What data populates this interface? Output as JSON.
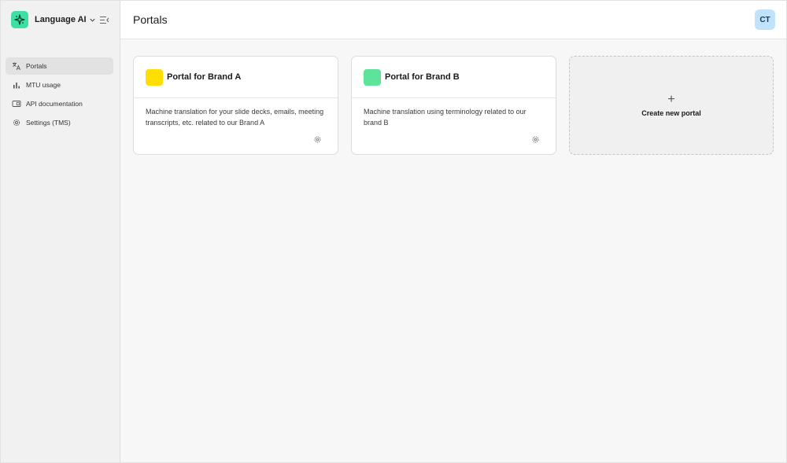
{
  "sidebar": {
    "app_name": "Language AI",
    "nav": [
      {
        "label": "Portals",
        "icon": "translate-icon",
        "active": true
      },
      {
        "label": "MTU usage",
        "icon": "bar-chart-icon",
        "active": false
      },
      {
        "label": "API documentation",
        "icon": "api-doc-icon",
        "active": false
      },
      {
        "label": "Settings (TMS)",
        "icon": "gear-icon",
        "active": false
      }
    ]
  },
  "header": {
    "title": "Portals",
    "avatar_initials": "CT"
  },
  "portals": [
    {
      "title": "Portal for Brand A",
      "description": "Machine translation for your slide decks, emails, meeting transcripts, etc. related to our Brand A",
      "color": "#ffde00"
    },
    {
      "title": "Portal for Brand B",
      "description": "Machine translation using terminology related to our brand B",
      "color": "#5ee39a"
    }
  ],
  "create_card": {
    "plus": "+",
    "label": "Create new portal"
  },
  "colors": {
    "brand_logo": "#3de0a3",
    "avatar_bg": "#bfe3fb"
  }
}
